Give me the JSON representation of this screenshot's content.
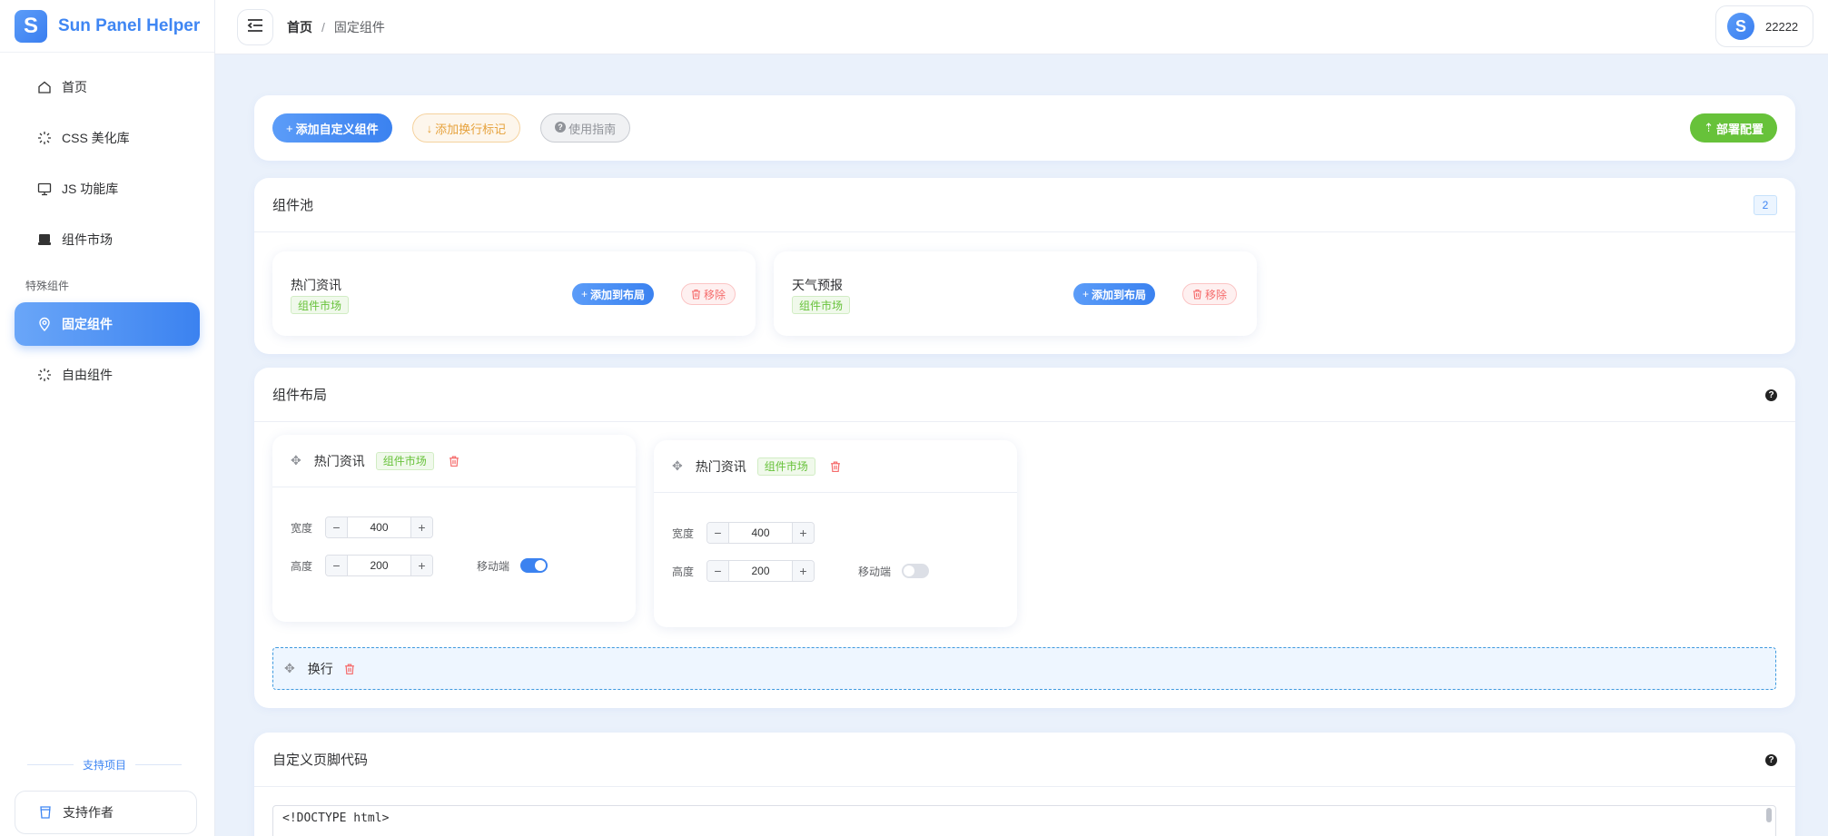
{
  "brand": {
    "logo_letter": "S",
    "title": "Sun Panel Helper"
  },
  "sidebar": {
    "items": [
      {
        "label": "首页",
        "icon": "home-icon"
      },
      {
        "label": "CSS 美化库",
        "icon": "sparkle-icon"
      },
      {
        "label": "JS 功能库",
        "icon": "monitor-icon"
      },
      {
        "label": "组件市场",
        "icon": "store-icon"
      }
    ],
    "group_label": "特殊组件",
    "special_items": [
      {
        "label": "固定组件",
        "icon": "pin-icon",
        "active": true
      },
      {
        "label": "自由组件",
        "icon": "sparkle-icon"
      }
    ],
    "support_divider": "支持项目",
    "support_button": "支持作者"
  },
  "header": {
    "breadcrumb_home": "首页",
    "breadcrumb_sep": "/",
    "breadcrumb_current": "固定组件",
    "user": {
      "avatar_letter": "S",
      "name": "22222"
    }
  },
  "toolbar": {
    "add_custom": "添加自定义组件",
    "add_break": "添加换行标记",
    "guide": "使用指南",
    "deploy": "部署配置"
  },
  "pool": {
    "title": "组件池",
    "count": "2",
    "items": [
      {
        "name": "热门资讯",
        "tag": "组件市场",
        "add_label": "添加到布局",
        "remove_label": "移除"
      },
      {
        "name": "天气预报",
        "tag": "组件市场",
        "add_label": "添加到布局",
        "remove_label": "移除"
      }
    ]
  },
  "layout": {
    "title": "组件布局",
    "help": "?",
    "items": [
      {
        "name": "热门资讯",
        "tag": "组件市场",
        "width_label": "宽度",
        "width": "400",
        "height_label": "高度",
        "height": "200",
        "mobile_label": "移动端",
        "mobile_on": true
      },
      {
        "name": "热门资讯",
        "tag": "组件市场",
        "width_label": "宽度",
        "width": "400",
        "height_label": "高度",
        "height": "200",
        "mobile_label": "移动端",
        "mobile_on": false
      }
    ],
    "break_label": "换行"
  },
  "footer_code": {
    "title": "自定义页脚代码",
    "help": "?",
    "code": "<!DOCTYPE html>"
  },
  "colors": {
    "primary": "#3b82f0",
    "success": "#67c23a",
    "warning": "#e6a23c",
    "danger": "#f56c6c"
  }
}
